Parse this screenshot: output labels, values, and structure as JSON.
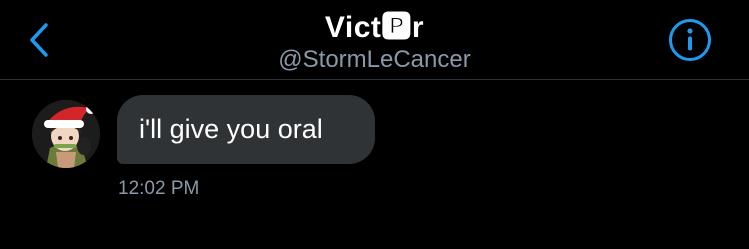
{
  "header": {
    "title": "Vict🅿r",
    "handle": "@StormLeCancer"
  },
  "icons": {
    "back": "chevron-left-icon",
    "info": "info-circle-icon",
    "avatar": "santa-hat-avatar"
  },
  "colors": {
    "accent": "#1d9bf0",
    "background": "#000000",
    "bubble": "#2f3336",
    "secondary_text": "#8b98a5"
  },
  "messages": [
    {
      "text": "i'll give you oral",
      "time": "12:02 PM"
    }
  ]
}
